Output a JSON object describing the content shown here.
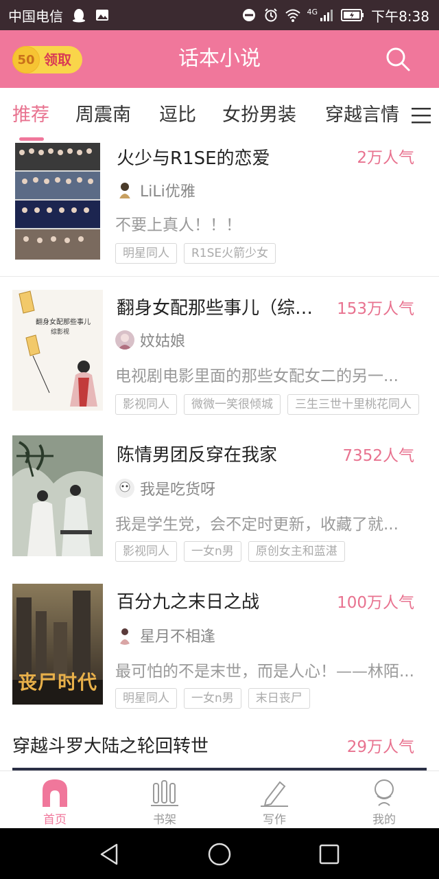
{
  "statusbar": {
    "carrier": "中国电信",
    "network": "4G",
    "time": "下午8:38"
  },
  "appbar": {
    "coin_count": "50",
    "claim_label": "领取",
    "title": "话本小说"
  },
  "tabs": [
    "推荐",
    "周震南",
    "逗比",
    "女扮男装",
    "穿越言情"
  ],
  "cards": [
    {
      "title": "火少与R1SE的恋爱",
      "popularity": "2万人气",
      "author": "LiLi优雅",
      "desc": "不要上真人！！！",
      "tags": [
        "明星同人",
        "R1SE火箭少女"
      ]
    },
    {
      "title": "翻身女配那些事儿（综影...",
      "popularity": "153万人气",
      "author": "妏姑娘",
      "desc": "电视剧电影里面的那些女配女二的另一...",
      "tags": [
        "影视同人",
        "微微一笑很倾城",
        "三生三世十里桃花同人"
      ],
      "cover_title": "翻身女配那些事儿",
      "cover_subtitle": "综影视"
    },
    {
      "title": "陈情男团反穿在我家",
      "popularity": "7352人气",
      "author": "我是吃货呀",
      "desc": "我是学生党，会不定时更新，收藏了就...",
      "tags": [
        "影视同人",
        "一女n男",
        "原创女主和蓝湛"
      ]
    },
    {
      "title": "百分九之末日之战",
      "popularity": "100万人气",
      "author": "星月不相逢",
      "desc": "最可怕的不是末世，而是人心！——林陌...",
      "tags": [
        "明星同人",
        "一女n男",
        "末日丧尸"
      ],
      "cover_title": "丧尸时代"
    },
    {
      "title": "穿越斗罗大陆之轮回转世",
      "popularity": "29万人气"
    }
  ],
  "bottomnav": [
    "首页",
    "书架",
    "写作",
    "我的"
  ],
  "colors": {
    "accent": "#f0779b",
    "statusbar": "#3b2a30",
    "coin": "#f9d54a"
  }
}
